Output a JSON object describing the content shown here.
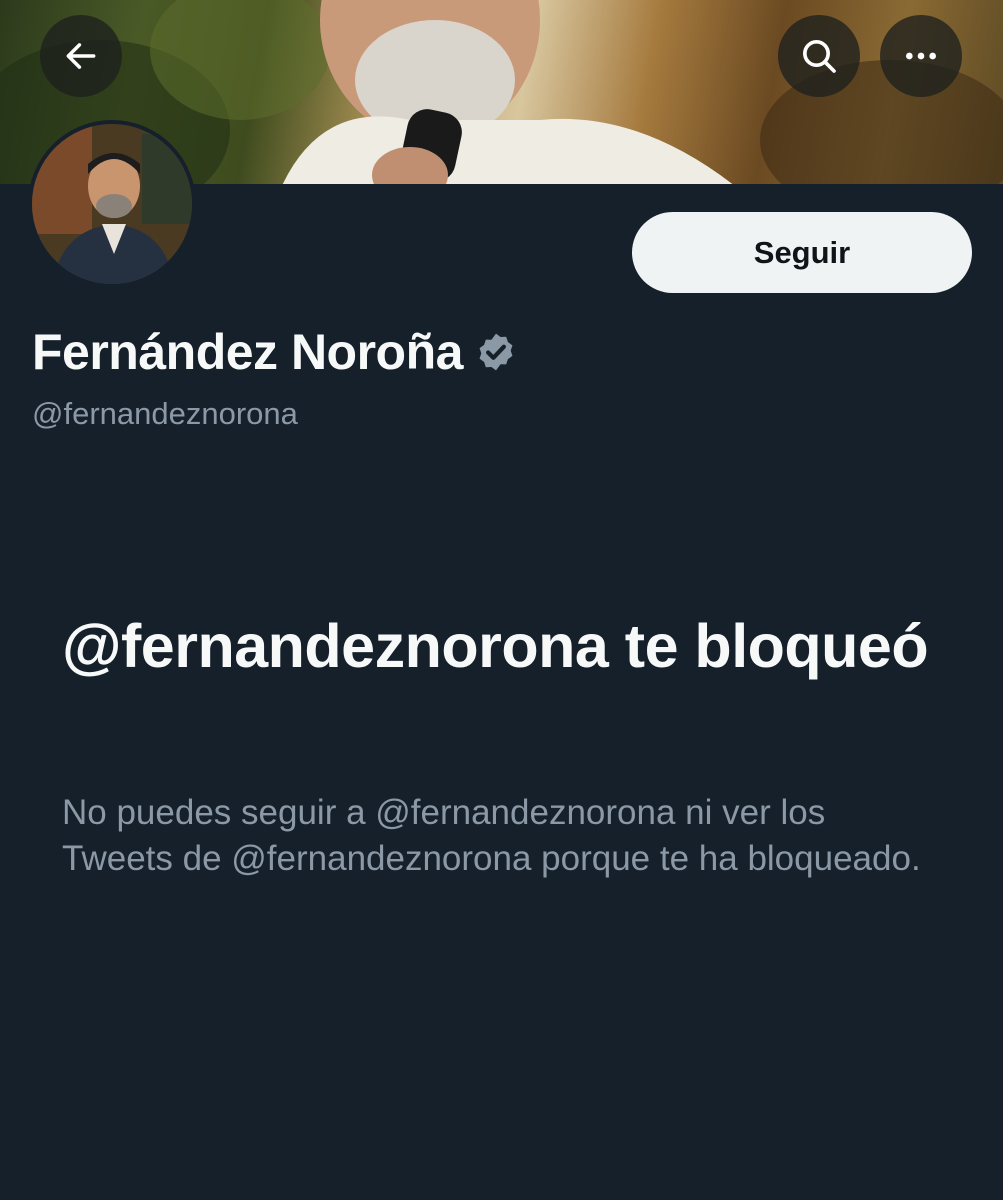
{
  "header": {
    "back_icon": "arrow-left-icon",
    "search_icon": "search-icon",
    "more_icon": "more-horizontal-icon"
  },
  "profile": {
    "display_name": "Fernández Noroña",
    "verified_icon": "verified-badge-icon",
    "handle": "@fernandeznorona",
    "follow_label": "Seguir"
  },
  "blocked": {
    "title": "@fernandeznorona te bloqueó",
    "message": "No puedes seguir a @fernandeznorona ni ver los Tweets de @fernandeznorona porque te ha bloqueado."
  },
  "colors": {
    "background": "#15202b",
    "primary_text": "#f7f9f9",
    "secondary_text": "#8b98a5",
    "button_bg": "#eff3f4",
    "verified": "#8b98a5"
  }
}
